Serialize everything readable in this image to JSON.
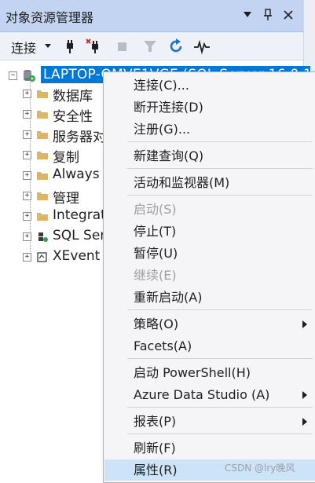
{
  "panel": {
    "title": "对象资源管理器",
    "buttons": {
      "dropdown": "▼",
      "pin": "⊓",
      "close": "✕"
    }
  },
  "toolbar": {
    "connect_label": "连接",
    "icons": [
      "connect-plug-icon",
      "disconnect-plug-icon",
      "stop-icon",
      "filter-icon",
      "refresh-icon",
      "activity-monitor-icon"
    ]
  },
  "tree": {
    "root": {
      "expander": "−",
      "label": "LAPTOP-QMVE1VGE (SQL Server 16.0.1"
    },
    "children": [
      {
        "expander": "+",
        "label": "数据库",
        "icon": "folder-icon"
      },
      {
        "expander": "+",
        "label": "安全性",
        "icon": "folder-icon"
      },
      {
        "expander": "+",
        "label": "服务器对",
        "icon": "folder-icon"
      },
      {
        "expander": "+",
        "label": "复制",
        "icon": "folder-icon"
      },
      {
        "expander": "+",
        "label": "Always",
        "icon": "folder-icon"
      },
      {
        "expander": "+",
        "label": "管理",
        "icon": "folder-icon"
      },
      {
        "expander": "+",
        "label": "Integrat",
        "icon": "folder-icon"
      },
      {
        "expander": "+",
        "label": "SQL Ser",
        "icon": "sql-agent-icon"
      },
      {
        "expander": "+",
        "label": "XEvent",
        "icon": "xevent-icon"
      }
    ]
  },
  "menu": {
    "items": [
      {
        "label": "连接(C)...",
        "enabled": true,
        "submenu": false
      },
      {
        "label": "断开连接(D)",
        "enabled": true,
        "submenu": false
      },
      {
        "label": "注册(G)...",
        "enabled": true,
        "submenu": false
      },
      {
        "label": "新建查询(Q)",
        "enabled": true,
        "submenu": false
      },
      {
        "label": "活动和监视器(M)",
        "enabled": true,
        "submenu": false
      },
      {
        "label": "启动(S)",
        "enabled": false,
        "submenu": false
      },
      {
        "label": "停止(T)",
        "enabled": true,
        "submenu": false
      },
      {
        "label": "暂停(U)",
        "enabled": true,
        "submenu": false
      },
      {
        "label": "继续(E)",
        "enabled": false,
        "submenu": false
      },
      {
        "label": "重新启动(A)",
        "enabled": true,
        "submenu": false
      },
      {
        "label": "策略(O)",
        "enabled": true,
        "submenu": true
      },
      {
        "label": "Facets(A)",
        "enabled": true,
        "submenu": false
      },
      {
        "label": "启动 PowerShell(H)",
        "enabled": true,
        "submenu": false
      },
      {
        "label": "Azure Data Studio (A)",
        "enabled": true,
        "submenu": true
      },
      {
        "label": "报表(P)",
        "enabled": true,
        "submenu": true
      },
      {
        "label": "刷新(F)",
        "enabled": true,
        "submenu": false
      },
      {
        "label": "属性(R)",
        "enabled": true,
        "submenu": false,
        "highlighted": true
      }
    ]
  },
  "watermark": "CSDN @lry晚风",
  "colors": {
    "title_bar": "#c2d4f2",
    "selection": "#0078d7",
    "menu_highlight": "#cde3f7",
    "folder": "#dcb567"
  }
}
